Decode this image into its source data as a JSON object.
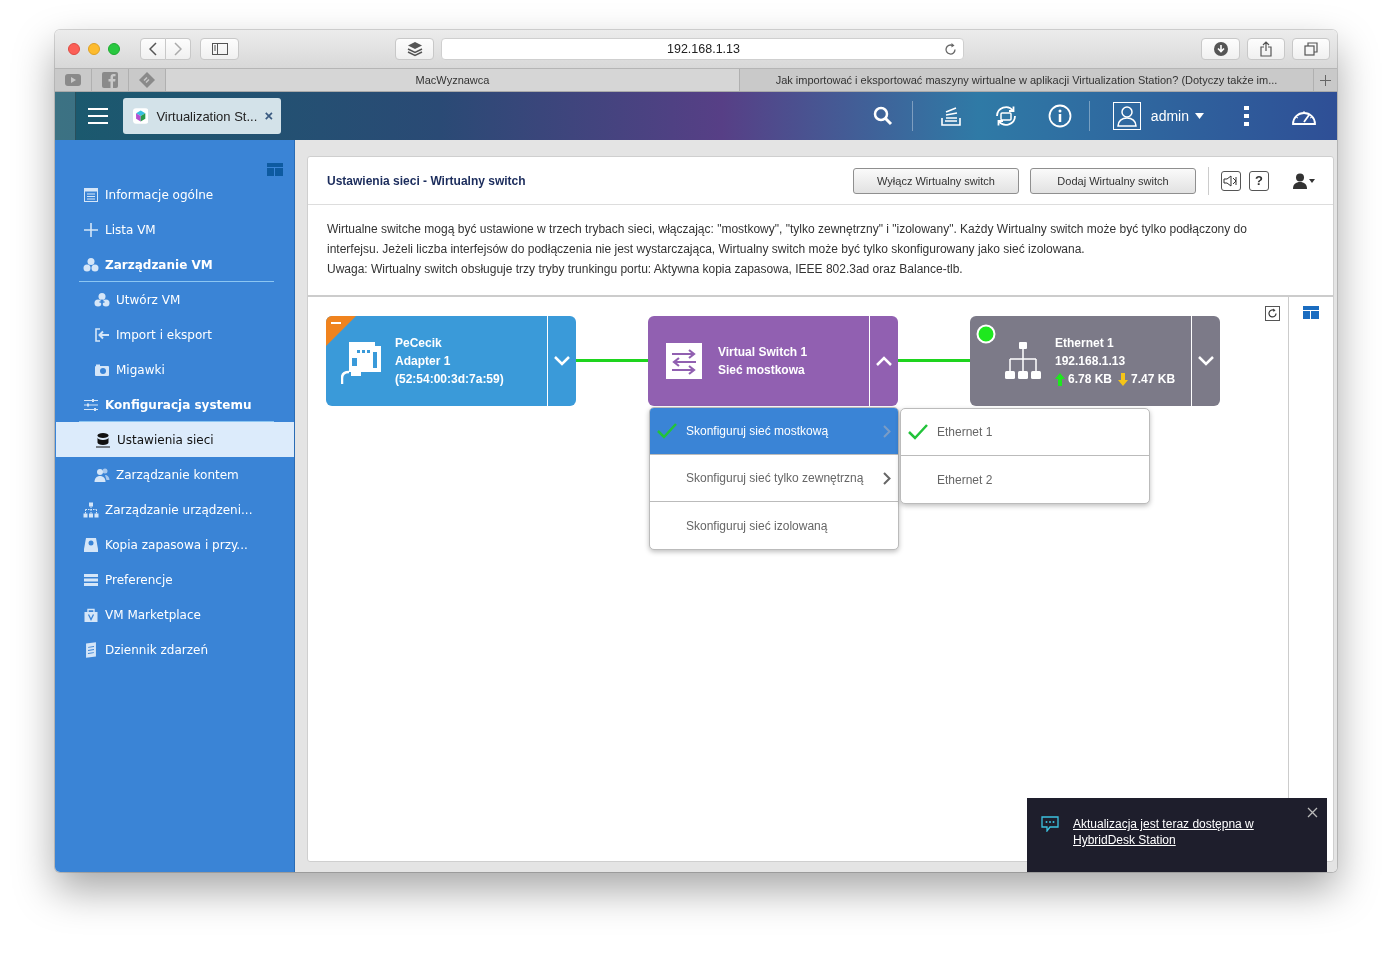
{
  "browser": {
    "url": "192.168.1.13",
    "tabs": [
      {
        "title": "MacWyznawca",
        "selected": true
      },
      {
        "title": "Jak importować i eksportować maszyny wirtualne w aplikacji Virtualization Station? (Dotyczy także im...",
        "selected": false
      }
    ]
  },
  "app_bar": {
    "app_tab": "Virtualization St...",
    "user": "admin"
  },
  "sidebar": {
    "items": [
      {
        "label": "Informacje ogólne",
        "kind": "item",
        "selected": false
      },
      {
        "label": "Lista VM",
        "kind": "item",
        "selected": false
      },
      {
        "label": "Zarządzanie VM",
        "kind": "section",
        "selected": false,
        "expanded": true,
        "children": [
          {
            "label": "Utwórz VM",
            "selected": false
          },
          {
            "label": "Import i eksport",
            "selected": false
          },
          {
            "label": "Migawki",
            "selected": false
          }
        ]
      },
      {
        "label": "Konfiguracja systemu",
        "kind": "section",
        "selected": false,
        "expanded": true,
        "children": [
          {
            "label": "Ustawienia sieci",
            "selected": true
          },
          {
            "label": "Zarządzanie kontem",
            "selected": false
          }
        ]
      },
      {
        "label": "Zarządzanie urządzeni...",
        "kind": "item",
        "selected": false
      },
      {
        "label": "Kopia zapasowa i przy...",
        "kind": "item",
        "selected": false
      },
      {
        "label": "Preferencje",
        "kind": "item",
        "selected": false
      },
      {
        "label": "VM Marketplace",
        "kind": "item",
        "selected": false
      },
      {
        "label": "Dziennik zdarzeń",
        "kind": "item",
        "selected": false
      }
    ]
  },
  "panel": {
    "title": "Ustawienia sieci - Wirtualny switch",
    "buttons": [
      "Wyłącz Wirtualny switch",
      "Dodaj Wirtualny switch"
    ],
    "help": "?",
    "description": [
      "Wirtualne switche mogą być ustawione w trzech trybach sieci, włączając: \"mostkowy\", \"tylko zewnętrzny\" i \"izolowany\". Każdy Wirtualny switch może być tylko podłączony do interfejsu. Jeżeli liczba interfejsów do podłączenia nie jest wystarczająca, Wirtualny switch może być tylko skonfigurowany jako sieć izolowana.",
      "Uwaga: Wirtualny switch obsługuje trzy tryby trunkingu portu: Aktywna kopia zapasowa, IEEE 802.3ad oraz Balance-tlb."
    ]
  },
  "diagram": {
    "nodes": [
      {
        "kind": "adapter",
        "lines": [
          "PeCecik",
          "Adapter 1",
          "(52:54:00:3d:7a:59)"
        ],
        "expanded": false
      },
      {
        "kind": "switch",
        "lines": [
          "Virtual Switch 1",
          "Sieć mostkowa"
        ],
        "expanded": true
      },
      {
        "kind": "ethernet",
        "lines": [
          "Ethernet 1",
          "192.168.1.13"
        ],
        "upload": "6.78 KB",
        "download": "7.47 KB",
        "connected": true,
        "expanded": false
      }
    ],
    "menu": [
      {
        "label": "Skonfiguruj sieć mostkową",
        "selected": true,
        "submenu": true
      },
      {
        "label": "Skonfiguruj sieć tylko zewnętrzną",
        "selected": false,
        "submenu": true
      },
      {
        "label": "Skonfiguruj sieć izolowaną",
        "selected": false,
        "submenu": false
      }
    ],
    "submenu": [
      {
        "label": "Ethernet 1",
        "checked": true
      },
      {
        "label": "Ethernet 2",
        "checked": false
      }
    ]
  },
  "notification": {
    "text": "Aktualizacja jest teraz dostępna w HybridDesk Station"
  }
}
